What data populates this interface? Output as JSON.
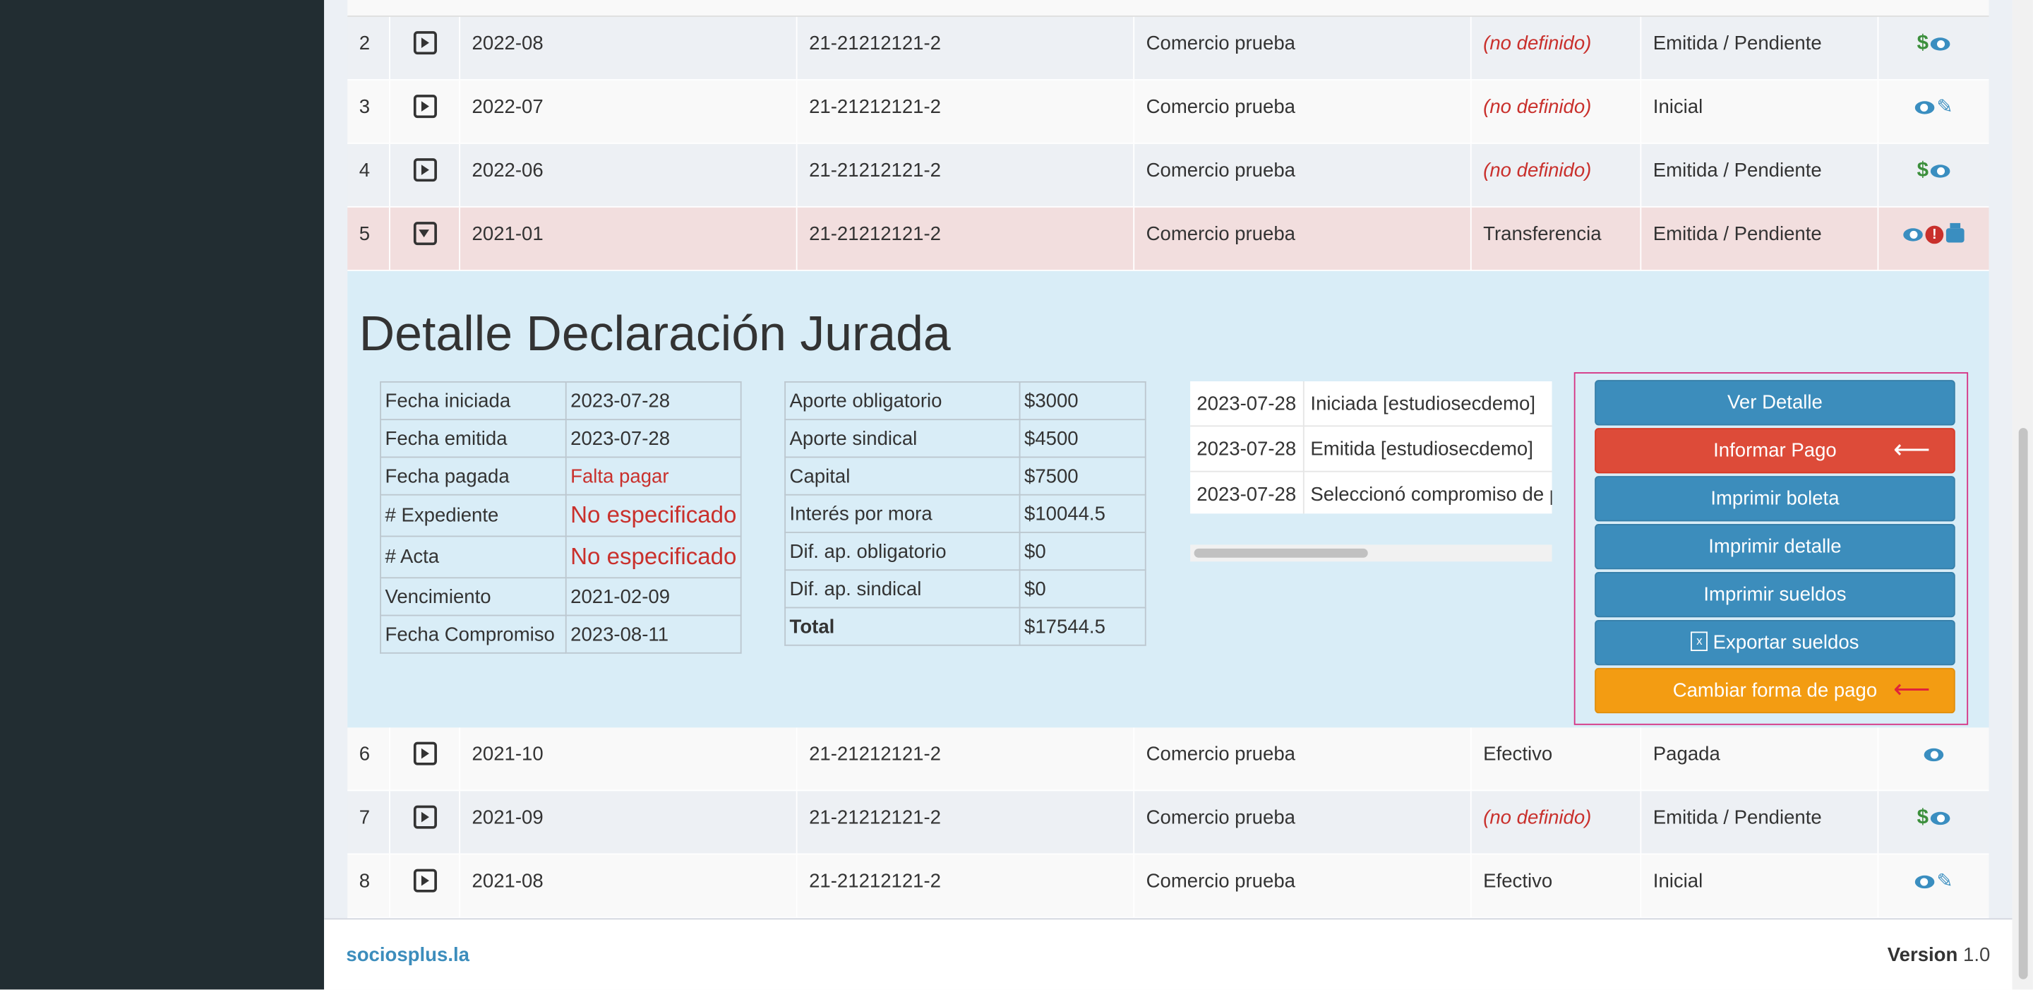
{
  "table": {
    "rows_top": [
      {
        "n": "2",
        "period": "2022-08",
        "cuit": "21-21212121-2",
        "comercio": "Comercio prueba",
        "forma_pago": "(no definido)",
        "estado": "Emitida / Pendiente"
      },
      {
        "n": "3",
        "period": "2022-07",
        "cuit": "21-21212121-2",
        "comercio": "Comercio prueba",
        "forma_pago": "(no definido)",
        "estado": "Inicial"
      },
      {
        "n": "4",
        "period": "2022-06",
        "cuit": "21-21212121-2",
        "comercio": "Comercio prueba",
        "forma_pago": "(no definido)",
        "estado": "Emitida / Pendiente"
      },
      {
        "n": "5",
        "period": "2021-01",
        "cuit": "21-21212121-2",
        "comercio": "Comercio prueba",
        "forma_pago": "Transferencia",
        "estado": "Emitida / Pendiente"
      }
    ],
    "rows_bottom": [
      {
        "n": "6",
        "period": "2021-10",
        "cuit": "21-21212121-2",
        "comercio": "Comercio prueba",
        "forma_pago": "Efectivo",
        "estado": "Pagada"
      },
      {
        "n": "7",
        "period": "2021-09",
        "cuit": "21-21212121-2",
        "comercio": "Comercio prueba",
        "forma_pago": "(no definido)",
        "estado": "Emitida / Pendiente"
      },
      {
        "n": "8",
        "period": "2021-08",
        "cuit": "21-21212121-2",
        "comercio": "Comercio prueba",
        "forma_pago": "Efectivo",
        "estado": "Inicial"
      }
    ],
    "icons": {
      "dollar": "$",
      "pencil": "✎",
      "alert": "!"
    }
  },
  "detail": {
    "title": "Detalle Declaración Jurada",
    "dates": [
      {
        "label": "Fecha iniciada",
        "value": "2023-07-28"
      },
      {
        "label": "Fecha emitida",
        "value": "2023-07-28"
      },
      {
        "label": "Fecha pagada",
        "value": "Falta pagar"
      },
      {
        "label": "# Expediente",
        "value": "No especificado"
      },
      {
        "label": "# Acta",
        "value": "No especificado"
      },
      {
        "label": "Vencimiento",
        "value": "2021-02-09"
      },
      {
        "label": "Fecha Compromiso",
        "value": "2023-08-11"
      }
    ],
    "amounts": [
      {
        "label": "Aporte obligatorio",
        "value": "$3000"
      },
      {
        "label": "Aporte sindical",
        "value": "$4500"
      },
      {
        "label": "Capital",
        "value": "$7500"
      },
      {
        "label": "Interés por mora",
        "value": "$10044.5"
      },
      {
        "label": "Dif. ap. obligatorio",
        "value": "$0"
      },
      {
        "label": "Dif. ap. sindical",
        "value": "$0"
      },
      {
        "label": "Total",
        "value": "$17544.5"
      }
    ],
    "history": [
      {
        "date": "2023-07-28",
        "event": "Iniciada [estudiosecdemo]"
      },
      {
        "date": "2023-07-28",
        "event": "Emitida [estudiosecdemo]"
      },
      {
        "date": "2023-07-28",
        "event": "Seleccionó compromiso de pago"
      }
    ],
    "buttons": {
      "ver_detalle": "Ver Detalle",
      "informar_pago": "Informar Pago",
      "imprimir_boleta": "Imprimir boleta",
      "imprimir_detalle": "Imprimir detalle",
      "imprimir_sueldos": "Imprimir sueldos",
      "exportar_sueldos": "Exportar sueldos",
      "cambiar_forma_pago": "Cambiar forma de pago",
      "arrow": "⟵",
      "excel_glyph": "x"
    }
  },
  "footer": {
    "brand": "sociosplus.la",
    "version_label": "Version",
    "version_value": "1.0"
  },
  "colors": {
    "sidebar": "#222d32",
    "detail_bg": "#d9edf7",
    "danger_row": "#f2dede",
    "primary": "#3c8dbc",
    "danger": "#dd4b39",
    "warning": "#f39c12",
    "highlight_border": "#d63384"
  }
}
